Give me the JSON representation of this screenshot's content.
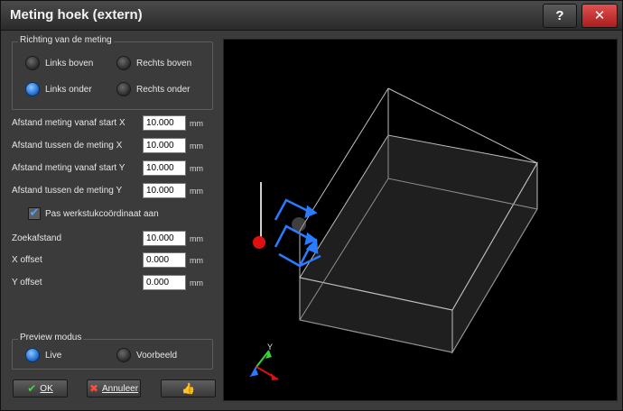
{
  "window": {
    "title": "Meting hoek (extern)",
    "help_label": "?",
    "close_label": "✕"
  },
  "direction": {
    "legend": "Richting van de meting",
    "options": [
      {
        "label": "Links boven",
        "selected": false
      },
      {
        "label": "Rechts boven",
        "selected": false
      },
      {
        "label": "Links onder",
        "selected": true
      },
      {
        "label": "Rechts onder",
        "selected": false
      }
    ]
  },
  "fields": [
    {
      "label": "Afstand meting vanaf start X",
      "value": "10.000",
      "unit": "mm"
    },
    {
      "label": "Afstand tussen de meting X",
      "value": "10.000",
      "unit": "mm"
    },
    {
      "label": "Afstand meting vanaf start Y",
      "value": "10.000",
      "unit": "mm"
    },
    {
      "label": "Afstand tussen de meting Y",
      "value": "10.000",
      "unit": "mm"
    }
  ],
  "checkbox": {
    "label": "Pas werkstukcoördinaat aan",
    "checked": true
  },
  "fields2": [
    {
      "label": "Zoekafstand",
      "value": "10.000",
      "unit": "mm"
    },
    {
      "label": "X offset",
      "value": "0.000",
      "unit": "mm"
    },
    {
      "label": "Y offset",
      "value": "0.000",
      "unit": "mm"
    }
  ],
  "preview": {
    "legend": "Preview modus",
    "options": [
      {
        "label": "Live",
        "selected": true
      },
      {
        "label": "Voorbeeld",
        "selected": false
      }
    ]
  },
  "buttons": {
    "ok_label": "OK",
    "cancel_label": "Annuleer"
  },
  "axes": {
    "y_label": "Y"
  },
  "colors": {
    "accent": "#2b7bff",
    "probe": "#e01010",
    "ok_icon": "#4bd14b",
    "cancel_icon": "#ff4a3d"
  }
}
